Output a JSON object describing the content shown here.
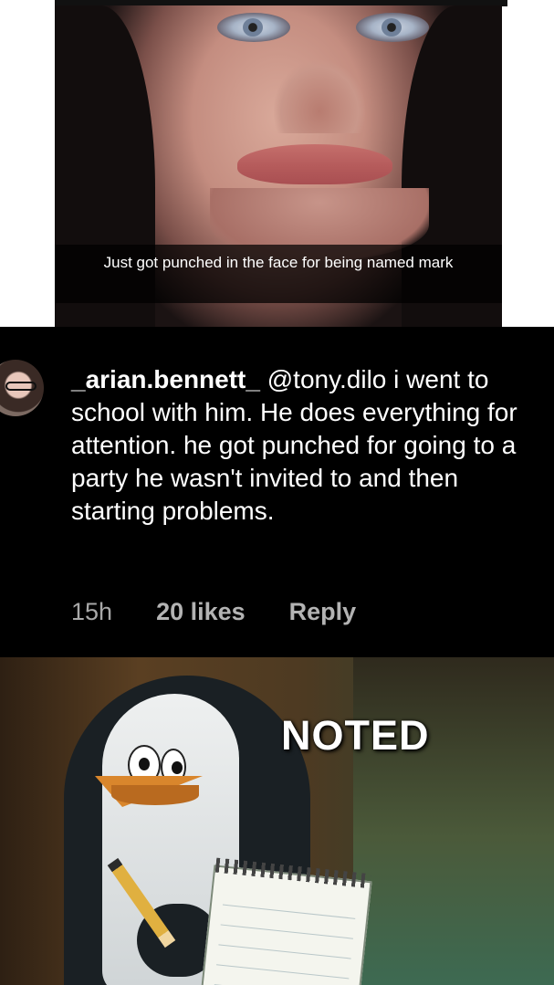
{
  "meme_top": {
    "caption": "Just got punched in the face for being named mark"
  },
  "comment": {
    "username": "_arian.bennett_",
    "text": "@tony.dilo i went to school with him. He does everything for attention. he got punched for going to a party he wasn't invited to and then starting problems.",
    "time_ago": "15h",
    "likes": "20 likes",
    "reply_label": "Reply"
  },
  "meme_bottom": {
    "caption": "NOTED"
  }
}
